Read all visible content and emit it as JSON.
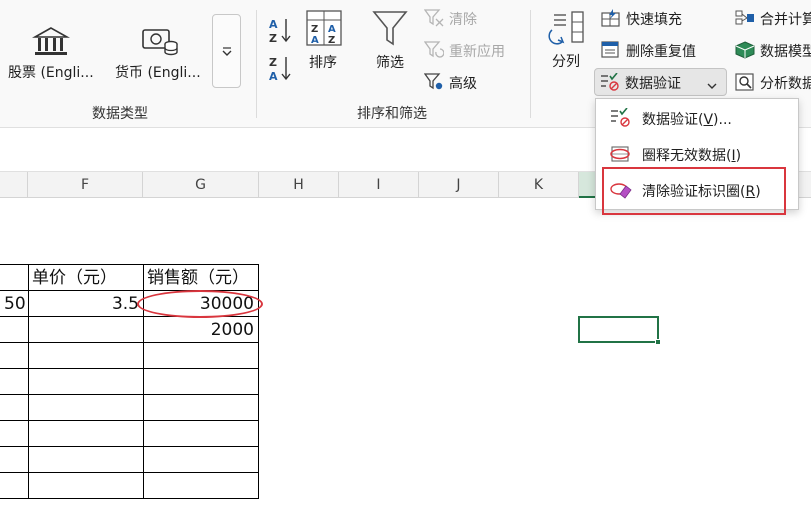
{
  "ribbon": {
    "data_types": {
      "stocks_label": "股票 (Engli...",
      "currency_label": "货币 (Engli...",
      "group_label": "数据类型"
    },
    "sort_filter": {
      "sort_label": "排序",
      "filter_label": "筛选",
      "clear_label": "清除",
      "reapply_label": "重新应用",
      "advanced_label": "高级",
      "group_label": "排序和筛选"
    },
    "data_tools": {
      "split_label": "分列",
      "flash_fill_label": "快速填充",
      "remove_dup_label": "删除重复值",
      "data_validation_label": "数据验证",
      "consolidate_label": "合并计算",
      "data_model_label": "数据模型",
      "analysis_label": "分析数据"
    }
  },
  "dropdown": {
    "items": [
      {
        "label": "数据验证(",
        "key": "V",
        "suffix": ")..."
      },
      {
        "label": "圈释无效数据(",
        "key": "I",
        "suffix": ")"
      },
      {
        "label": "清除验证标识圈(",
        "key": "R",
        "suffix": ")"
      }
    ]
  },
  "columns": [
    "F",
    "G",
    "H",
    "I",
    "J",
    "K"
  ],
  "table": {
    "header": [
      "单价（元）",
      "销售额（元）"
    ],
    "rows": [
      {
        "e": "50",
        "f": "3.5",
        "g": "30000"
      },
      {
        "e": "",
        "f": "",
        "g": "2000"
      }
    ]
  },
  "colors": {
    "accent_green": "#217346",
    "circle_red": "#d9363e"
  }
}
